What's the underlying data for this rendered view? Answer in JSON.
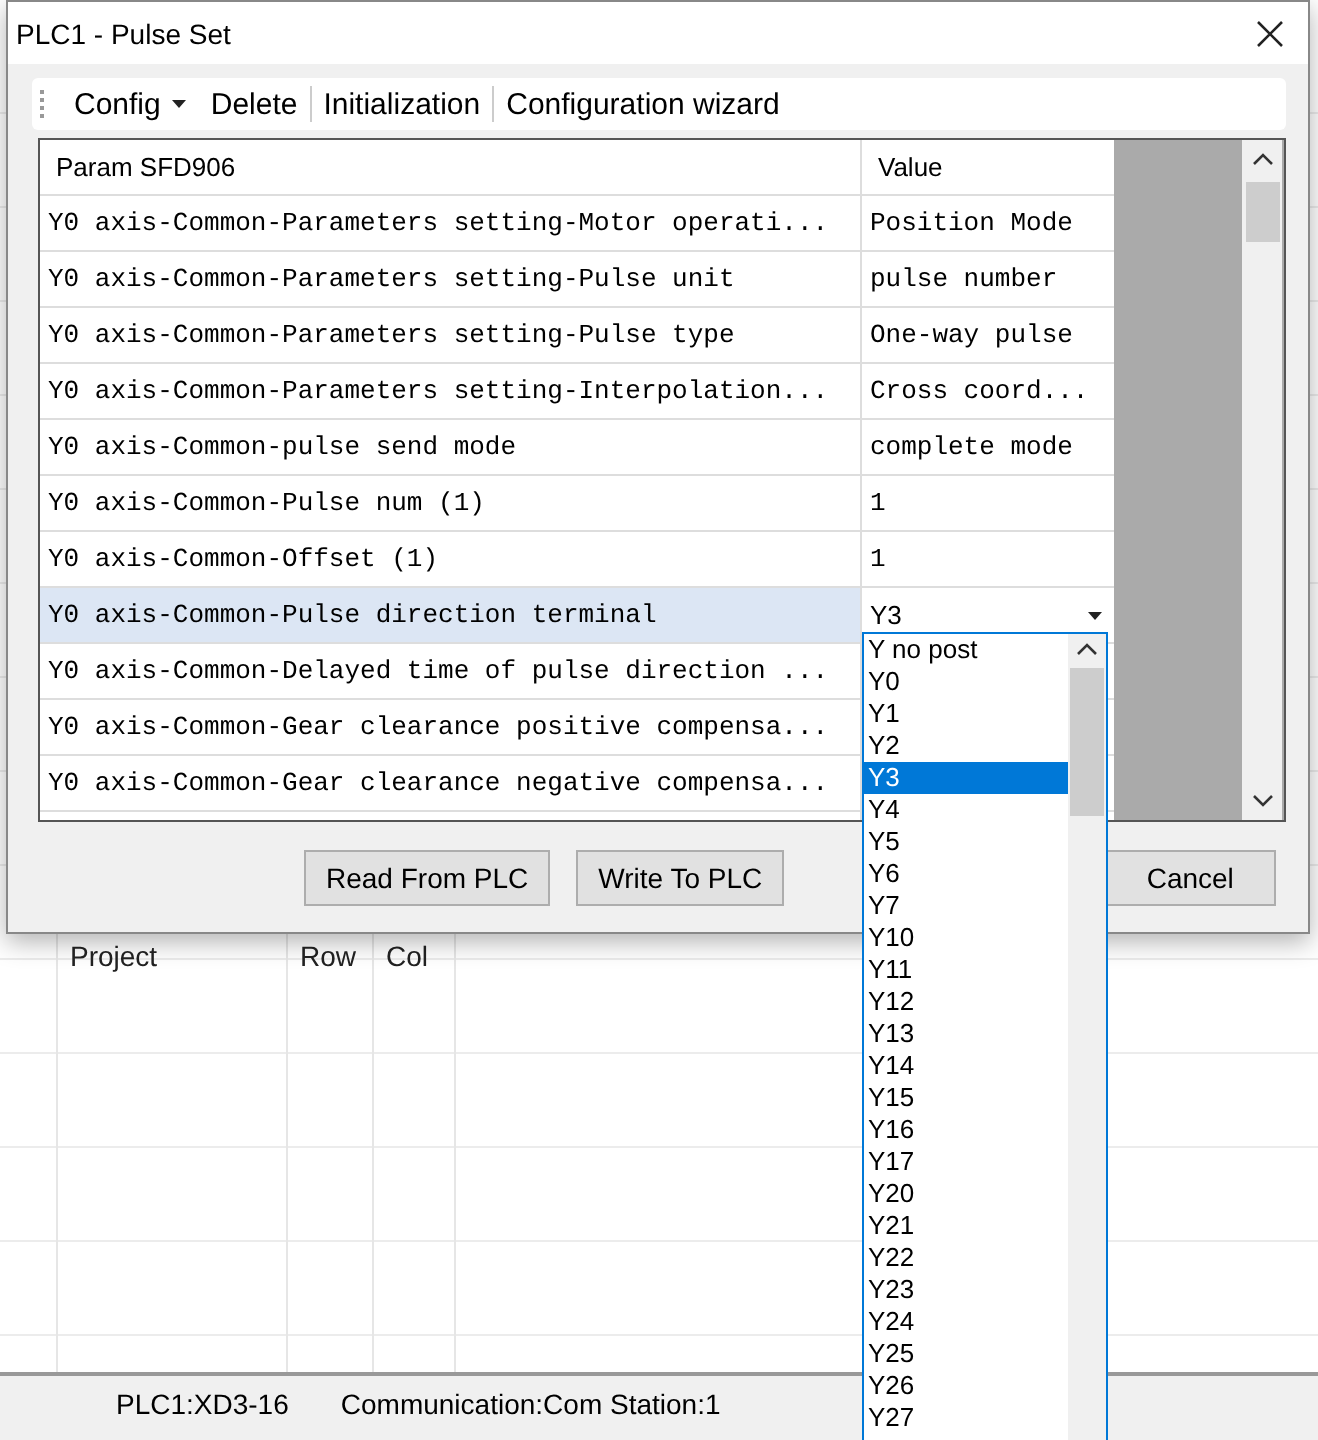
{
  "background": {
    "columns": [
      "Project",
      "Row",
      "Col"
    ],
    "status_bar": [
      "PLC1:XD3-16",
      "Communication:Com Station:1"
    ]
  },
  "dialog": {
    "title": "PLC1 - Pulse  Set",
    "toolbar": [
      {
        "label": "Config",
        "has_menu": true
      },
      {
        "label": "Delete",
        "has_menu": false
      },
      {
        "label": "Initialization",
        "has_menu": false
      },
      {
        "label": "Configuration wizard",
        "has_menu": false
      }
    ],
    "table": {
      "columns": [
        "Param SFD906",
        "Value"
      ],
      "rows": [
        {
          "param": "Y0 axis-Common-Parameters setting-Motor operati...",
          "value": "Position Mode",
          "selected": false,
          "kind": "text"
        },
        {
          "param": "Y0 axis-Common-Parameters setting-Pulse unit",
          "value": "pulse number",
          "selected": false,
          "kind": "text"
        },
        {
          "param": "Y0 axis-Common-Parameters setting-Pulse type",
          "value": "One-way pulse",
          "selected": false,
          "kind": "text"
        },
        {
          "param": "Y0 axis-Common-Parameters setting-Interpolation...",
          "value": "Cross coord...",
          "selected": false,
          "kind": "text"
        },
        {
          "param": "Y0 axis-Common-pulse send mode",
          "value": "complete mode",
          "selected": false,
          "kind": "text"
        },
        {
          "param": "Y0 axis-Common-Pulse num (1)",
          "value": "1",
          "selected": false,
          "kind": "text"
        },
        {
          "param": "Y0 axis-Common-Offset (1)",
          "value": "1",
          "selected": false,
          "kind": "text"
        },
        {
          "param": "Y0 axis-Common-Pulse direction terminal",
          "value": "Y3",
          "selected": true,
          "kind": "combo"
        },
        {
          "param": "Y0 axis-Common-Delayed time of pulse direction ...",
          "value": "",
          "selected": false,
          "kind": "text"
        },
        {
          "param": "Y0 axis-Common-Gear clearance positive compensa...",
          "value": "",
          "selected": false,
          "kind": "text"
        },
        {
          "param": "Y0 axis-Common-Gear clearance negative compensa...",
          "value": "",
          "selected": false,
          "kind": "text"
        }
      ]
    },
    "dropdown": [
      {
        "label": "Y no post",
        "selected": false
      },
      {
        "label": "Y0",
        "selected": false
      },
      {
        "label": "Y1",
        "selected": false
      },
      {
        "label": "Y2",
        "selected": false
      },
      {
        "label": "Y3",
        "selected": true
      },
      {
        "label": "Y4",
        "selected": false
      },
      {
        "label": "Y5",
        "selected": false
      },
      {
        "label": "Y6",
        "selected": false
      },
      {
        "label": "Y7",
        "selected": false
      },
      {
        "label": "Y10",
        "selected": false
      },
      {
        "label": "Y11",
        "selected": false
      },
      {
        "label": "Y12",
        "selected": false
      },
      {
        "label": "Y13",
        "selected": false
      },
      {
        "label": "Y14",
        "selected": false
      },
      {
        "label": "Y15",
        "selected": false
      },
      {
        "label": "Y16",
        "selected": false
      },
      {
        "label": "Y17",
        "selected": false
      },
      {
        "label": "Y20",
        "selected": false
      },
      {
        "label": "Y21",
        "selected": false
      },
      {
        "label": "Y22",
        "selected": false
      },
      {
        "label": "Y23",
        "selected": false
      },
      {
        "label": "Y24",
        "selected": false
      },
      {
        "label": "Y25",
        "selected": false
      },
      {
        "label": "Y26",
        "selected": false
      },
      {
        "label": "Y27",
        "selected": false
      }
    ],
    "buttons": [
      "Read From PLC",
      "Write To PLC",
      "Cancel"
    ]
  }
}
